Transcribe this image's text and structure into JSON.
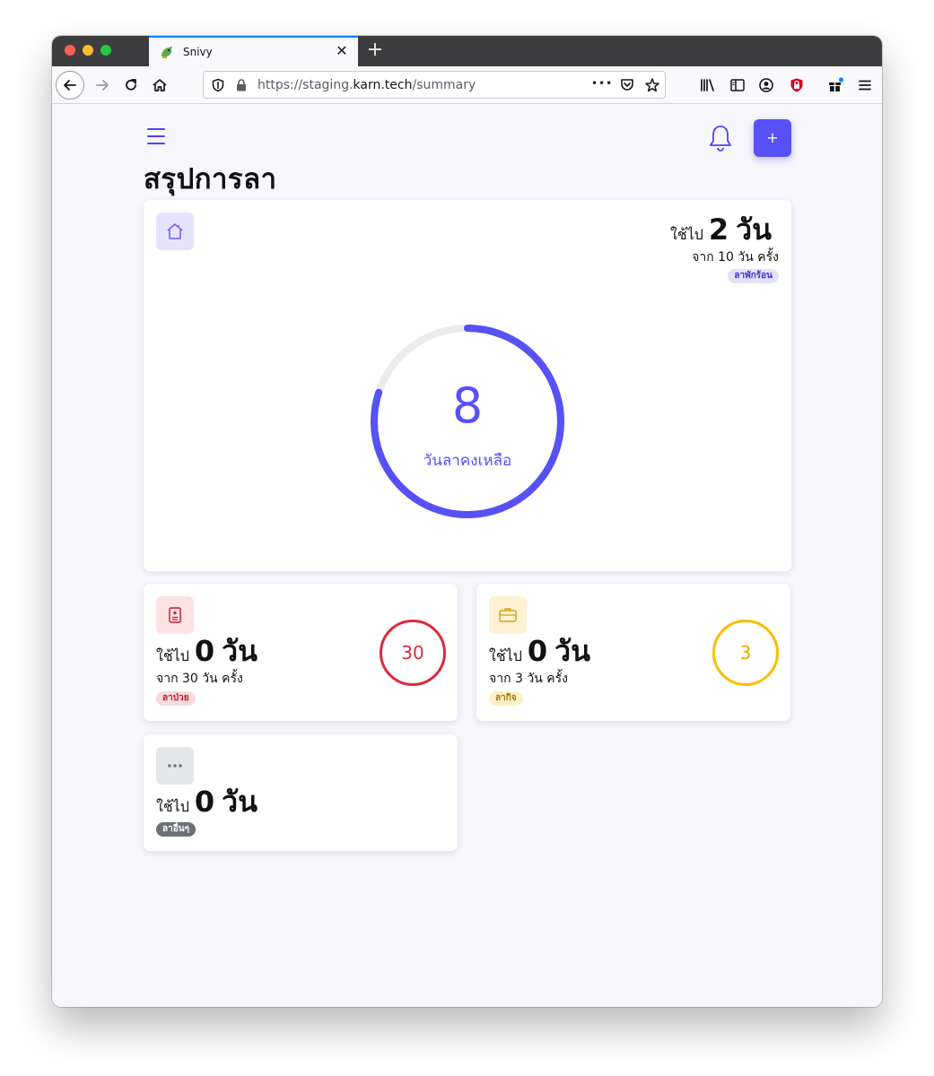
{
  "browser": {
    "tab_title": "Snivy",
    "url_prefix": "https://staging.",
    "url_host": "karn.tech",
    "url_path": "/summary",
    "url_dots": "•••"
  },
  "page": {
    "title": "สรุปการลา",
    "add_label": "+"
  },
  "vacation": {
    "used_prefix": "ใช้ไป",
    "used_value": "2",
    "used_unit": "วัน",
    "from_text": "จาก 10 วัน ครั้ง",
    "badge": "ลาพักร้อน",
    "remaining_value": "8",
    "remaining_label": "วันลาคงเหลือ",
    "used_fraction": 0.2
  },
  "sick": {
    "used_prefix": "ใช้ไป",
    "used_value": "0",
    "used_unit": "วัน",
    "from_text": "จาก 30 วัน ครั้ง",
    "badge": "ลาป่วย",
    "remaining_value": "30"
  },
  "personal": {
    "used_prefix": "ใช้ไป",
    "used_value": "0",
    "used_unit": "วัน",
    "from_text": "จาก 3 วัน ครั้ง",
    "badge": "ลากิจ",
    "remaining_value": "3"
  },
  "other": {
    "used_prefix": "ใช้ไป",
    "used_value": "0",
    "used_unit": "วัน",
    "badge": "ลาอื่นๆ"
  },
  "colors": {
    "accent": "#5851f6",
    "sick": "#dc2a3c",
    "personal": "#f6c000",
    "ring_track": "#ececec"
  }
}
